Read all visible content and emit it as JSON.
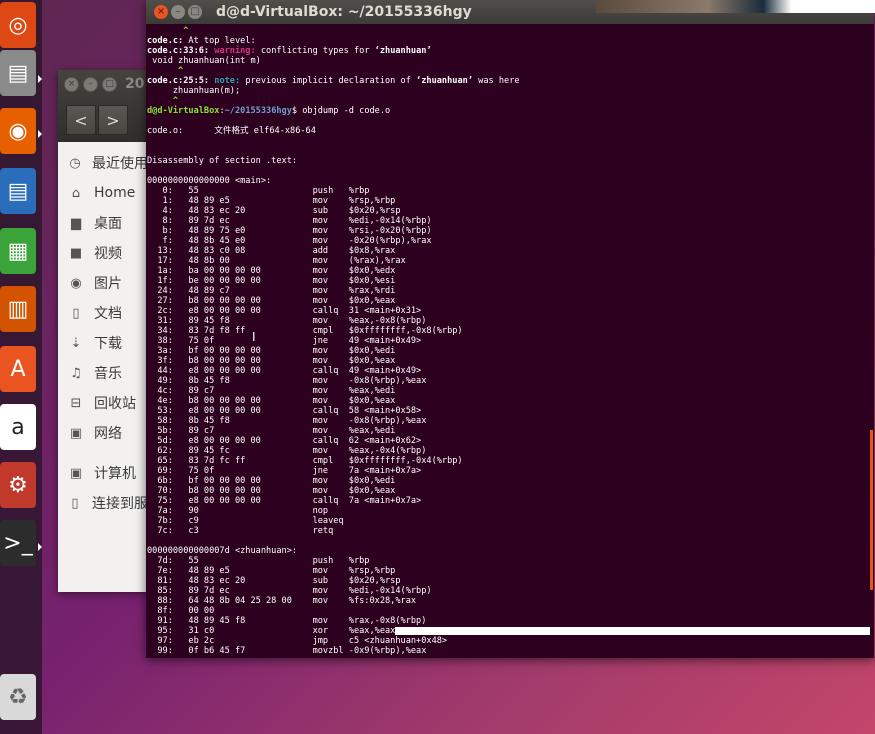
{
  "terminal": {
    "title": "d@d-VirtualBox: ~/20155336hgy",
    "close_glyph": "×",
    "min_glyph": "–",
    "max_glyph": "□"
  },
  "files": {
    "title": "20",
    "back": "<",
    "forward": ">",
    "sidebar": [
      {
        "icon": "clock-icon",
        "glyph": "◷",
        "label": "最近使用"
      },
      {
        "icon": "home-icon",
        "glyph": "⌂",
        "label": "Home"
      },
      {
        "icon": "folder-icon",
        "glyph": "▆",
        "label": "桌面"
      },
      {
        "icon": "video-icon",
        "glyph": "■",
        "label": "视频"
      },
      {
        "icon": "camera-icon",
        "glyph": "◉",
        "label": "图片"
      },
      {
        "icon": "document-icon",
        "glyph": "▯",
        "label": "文档"
      },
      {
        "icon": "download-icon",
        "glyph": "⇣",
        "label": "下载"
      },
      {
        "icon": "music-icon",
        "glyph": "♫",
        "label": "音乐"
      },
      {
        "icon": "trash-icon",
        "glyph": "⊟",
        "label": "回收站"
      },
      {
        "icon": "network-icon",
        "glyph": "▣",
        "label": "网络"
      },
      {
        "icon": "computer-icon",
        "glyph": "▣",
        "label": "计算机"
      },
      {
        "icon": "server-icon",
        "glyph": "▯",
        "label": "连接到服"
      }
    ]
  },
  "launcher": [
    {
      "name": "ubuntu-dash-icon",
      "glyph": "◎",
      "color": "#dd4814"
    },
    {
      "name": "files-icon",
      "glyph": "▤",
      "color": "#8a8a8a"
    },
    {
      "name": "firefox-icon",
      "glyph": "◉",
      "color": "#e66000"
    },
    {
      "name": "writer-icon",
      "glyph": "▤",
      "color": "#2a6ebb"
    },
    {
      "name": "calc-icon",
      "glyph": "▦",
      "color": "#3aa43a"
    },
    {
      "name": "impress-icon",
      "glyph": "▥",
      "color": "#d35400"
    },
    {
      "name": "software-center-icon",
      "glyph": "A",
      "color": "#e95420"
    },
    {
      "name": "amazon-icon",
      "glyph": "a",
      "color": "#ffffff"
    },
    {
      "name": "settings-icon",
      "glyph": "⚙",
      "color": "#c0392b"
    },
    {
      "name": "terminal-icon",
      "glyph": ">_",
      "color": "#2c2c2c"
    }
  ],
  "trash_glyph": "♻",
  "lines": [
    {
      "segs": [
        {
          "t": "       ^",
          "c": "grn"
        }
      ]
    },
    {
      "segs": [
        {
          "t": "code.c:",
          "c": "b"
        },
        {
          "t": " At top level:",
          "c": ""
        }
      ]
    },
    {
      "segs": [
        {
          "t": "code.c:33:6: ",
          "c": "b"
        },
        {
          "t": "warning: ",
          "c": "mag"
        },
        {
          "t": "conflicting types for ",
          "c": ""
        },
        {
          "t": "‘zhuanhuan’",
          "c": "b"
        }
      ]
    },
    {
      "segs": [
        {
          "t": " void zhuanhuan(int m)",
          "c": ""
        }
      ]
    },
    {
      "segs": [
        {
          "t": "      ^",
          "c": "grn"
        }
      ]
    },
    {
      "segs": [
        {
          "t": "code.c:25:5: ",
          "c": "b"
        },
        {
          "t": "note: ",
          "c": "cyan"
        },
        {
          "t": "previous implicit declaration of ",
          "c": ""
        },
        {
          "t": "‘zhuanhuan’",
          "c": "b"
        },
        {
          "t": " was here",
          "c": ""
        }
      ]
    },
    {
      "segs": [
        {
          "t": "     zhuanhuan(m);",
          "c": ""
        }
      ]
    },
    {
      "segs": [
        {
          "t": "     ^",
          "c": "grn"
        }
      ]
    },
    {
      "segs": [
        {
          "t": "d@d-VirtualBox",
          "c": "grn"
        },
        {
          "t": ":",
          "c": ""
        },
        {
          "t": "~/20155336hgy",
          "c": "blu"
        },
        {
          "t": "$ objdump -d code.o",
          "c": ""
        }
      ]
    },
    {
      "segs": [
        {
          "t": "",
          "c": ""
        }
      ]
    },
    {
      "segs": [
        {
          "t": "code.o:      文件格式 elf64-x86-64",
          "c": ""
        }
      ]
    },
    {
      "segs": [
        {
          "t": "",
          "c": ""
        }
      ]
    },
    {
      "segs": [
        {
          "t": "",
          "c": ""
        }
      ]
    },
    {
      "segs": [
        {
          "t": "Disassembly of section .text:",
          "c": ""
        }
      ]
    },
    {
      "segs": [
        {
          "t": "",
          "c": ""
        }
      ]
    },
    {
      "segs": [
        {
          "t": "0000000000000000 <main>:",
          "c": ""
        }
      ]
    },
    {
      "segs": [
        {
          "t": "   0:   55                      push   %rbp",
          "c": ""
        }
      ]
    },
    {
      "segs": [
        {
          "t": "   1:   48 89 e5                mov    %rsp,%rbp",
          "c": ""
        }
      ]
    },
    {
      "segs": [
        {
          "t": "   4:   48 83 ec 20             sub    $0x20,%rsp",
          "c": ""
        }
      ]
    },
    {
      "segs": [
        {
          "t": "   8:   89 7d ec                mov    %edi,-0x14(%rbp)",
          "c": ""
        }
      ]
    },
    {
      "segs": [
        {
          "t": "   b:   48 89 75 e0             mov    %rsi,-0x20(%rbp)",
          "c": ""
        }
      ]
    },
    {
      "segs": [
        {
          "t": "   f:   48 8b 45 e0             mov    -0x20(%rbp),%rax",
          "c": ""
        }
      ]
    },
    {
      "segs": [
        {
          "t": "  13:   48 83 c0 08             add    $0x8,%rax",
          "c": ""
        }
      ]
    },
    {
      "segs": [
        {
          "t": "  17:   48 8b 00                mov    (%rax),%rax",
          "c": ""
        }
      ]
    },
    {
      "segs": [
        {
          "t": "  1a:   ba 00 00 00 00          mov    $0x0,%edx",
          "c": ""
        }
      ]
    },
    {
      "segs": [
        {
          "t": "  1f:   be 00 00 00 00          mov    $0x0,%esi",
          "c": ""
        }
      ]
    },
    {
      "segs": [
        {
          "t": "  24:   48 89 c7                mov    %rax,%rdi",
          "c": ""
        }
      ]
    },
    {
      "segs": [
        {
          "t": "  27:   b8 00 00 00 00          mov    $0x0,%eax",
          "c": ""
        }
      ]
    },
    {
      "segs": [
        {
          "t": "  2c:   e8 00 00 00 00          callq  31 <main+0x31>",
          "c": ""
        }
      ]
    },
    {
      "segs": [
        {
          "t": "  31:   89 45 f8                mov    %eax,-0x8(%rbp)",
          "c": ""
        }
      ]
    },
    {
      "segs": [
        {
          "t": "  34:   83 7d f8 ff             cmpl   $0xffffffff,-0x8(%rbp)",
          "c": ""
        }
      ]
    },
    {
      "segs": [
        {
          "t": "  38:   75 0f                   jne    49 <main+0x49>",
          "c": ""
        }
      ]
    },
    {
      "segs": [
        {
          "t": "  3a:   bf 00 00 00 00          mov    $0x0,%edi",
          "c": ""
        }
      ]
    },
    {
      "segs": [
        {
          "t": "  3f:   b8 00 00 00 00          mov    $0x0,%eax",
          "c": ""
        }
      ]
    },
    {
      "segs": [
        {
          "t": "  44:   e8 00 00 00 00          callq  49 <main+0x49>",
          "c": ""
        }
      ]
    },
    {
      "segs": [
        {
          "t": "  49:   8b 45 f8                mov    -0x8(%rbp),%eax",
          "c": ""
        }
      ]
    },
    {
      "segs": [
        {
          "t": "  4c:   89 c7                   mov    %eax,%edi",
          "c": ""
        }
      ]
    },
    {
      "segs": [
        {
          "t": "  4e:   b8 00 00 00 00          mov    $0x0,%eax",
          "c": ""
        }
      ]
    },
    {
      "segs": [
        {
          "t": "  53:   e8 00 00 00 00          callq  58 <main+0x58>",
          "c": ""
        }
      ]
    },
    {
      "segs": [
        {
          "t": "  58:   8b 45 f8                mov    -0x8(%rbp),%eax",
          "c": ""
        }
      ]
    },
    {
      "segs": [
        {
          "t": "  5b:   89 c7                   mov    %eax,%edi",
          "c": ""
        }
      ]
    },
    {
      "segs": [
        {
          "t": "  5d:   e8 00 00 00 00          callq  62 <main+0x62>",
          "c": ""
        }
      ]
    },
    {
      "segs": [
        {
          "t": "  62:   89 45 fc                mov    %eax,-0x4(%rbp)",
          "c": ""
        }
      ]
    },
    {
      "segs": [
        {
          "t": "  65:   83 7d fc ff             cmpl   $0xffffffff,-0x4(%rbp)",
          "c": ""
        }
      ]
    },
    {
      "segs": [
        {
          "t": "  69:   75 0f                   jne    7a <main+0x7a>",
          "c": ""
        }
      ]
    },
    {
      "segs": [
        {
          "t": "  6b:   bf 00 00 00 00          mov    $0x0,%edi",
          "c": ""
        }
      ]
    },
    {
      "segs": [
        {
          "t": "  70:   b8 00 00 00 00          mov    $0x0,%eax",
          "c": ""
        }
      ]
    },
    {
      "segs": [
        {
          "t": "  75:   e8 00 00 00 00          callq  7a <main+0x7a>",
          "c": ""
        }
      ]
    },
    {
      "segs": [
        {
          "t": "  7a:   90                      nop",
          "c": ""
        }
      ]
    },
    {
      "segs": [
        {
          "t": "  7b:   c9                      leaveq",
          "c": ""
        }
      ]
    },
    {
      "segs": [
        {
          "t": "  7c:   c3                      retq",
          "c": ""
        }
      ]
    },
    {
      "segs": [
        {
          "t": "",
          "c": ""
        }
      ]
    },
    {
      "segs": [
        {
          "t": "000000000000007d <zhuanhuan>:",
          "c": ""
        }
      ]
    },
    {
      "segs": [
        {
          "t": "  7d:   55                      push   %rbp",
          "c": ""
        }
      ]
    },
    {
      "segs": [
        {
          "t": "  7e:   48 89 e5                mov    %rsp,%rbp",
          "c": ""
        }
      ]
    },
    {
      "segs": [
        {
          "t": "  81:   48 83 ec 20             sub    $0x20,%rsp",
          "c": ""
        }
      ]
    },
    {
      "segs": [
        {
          "t": "  85:   89 7d ec                mov    %edi,-0x14(%rbp)",
          "c": ""
        }
      ]
    },
    {
      "segs": [
        {
          "t": "  88:   64 48 8b 04 25 28 00    mov    %fs:0x28,%rax",
          "c": ""
        }
      ]
    },
    {
      "segs": [
        {
          "t": "  8f:   00 00",
          "c": ""
        }
      ]
    },
    {
      "segs": [
        {
          "t": "  91:   48 89 45 f8             mov    %rax,-0x8(%rbp)",
          "c": ""
        }
      ]
    },
    {
      "segs": [
        {
          "t": "  95:   31 c0                   xor    %eax,%eax",
          "c": ""
        },
        {
          "t": "",
          "c": "wbar"
        }
      ]
    },
    {
      "segs": [
        {
          "t": "  97:   eb 2c                   jmp    c5 <zhuanhuan+0x48>",
          "c": ""
        }
      ]
    },
    {
      "segs": [
        {
          "t": "  99:   0f b6 45 f7             movzbl -0x9(%rbp),%eax",
          "c": ""
        }
      ]
    }
  ]
}
